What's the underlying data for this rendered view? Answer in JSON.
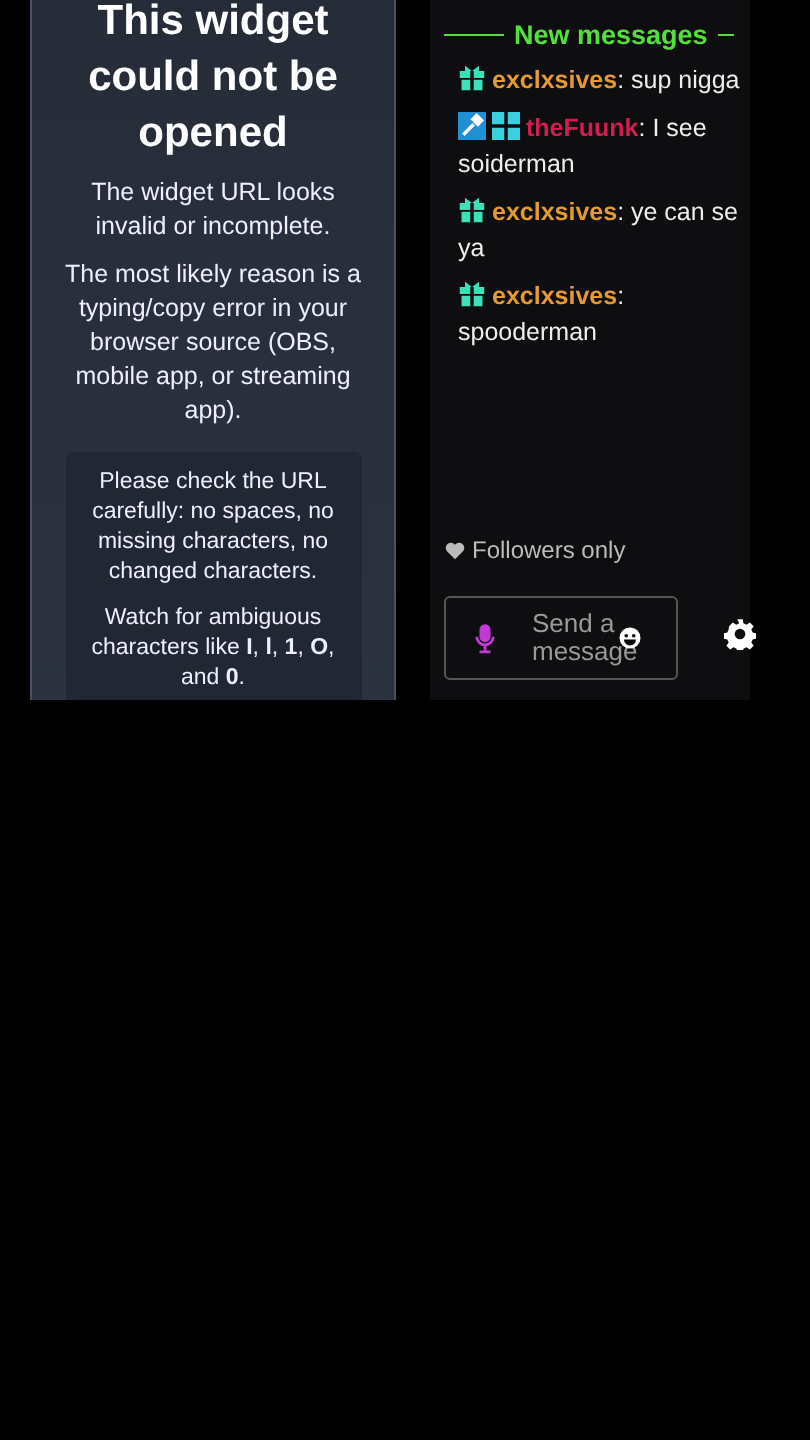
{
  "error_card": {
    "title": "This widget could not be opened",
    "paragraphs": [
      "The widget URL looks invalid or incomplete.",
      "The most likely reason is a typing/copy error in your browser source (OBS, mobile app, or streaming app)."
    ],
    "tip_box": [
      "Please check the URL carefully: no spaces, no missing characters, no changed characters.",
      "Watch for ambiguous characters like **I**, **l**, **1**, **O**, and **0**."
    ]
  },
  "chat": {
    "divider": "New messages",
    "messages": [
      {
        "badges": [
          {
            "kind": "gift"
          }
        ],
        "user": "exclxsives",
        "color": "#e39a35",
        "text": ": sup nigga"
      },
      {
        "badges": [
          {
            "kind": "hammer"
          },
          {
            "kind": "grid"
          }
        ],
        "user": "theFuunk",
        "color": "#d11d50",
        "text": ": I see soiderman"
      },
      {
        "badges": [
          {
            "kind": "gift"
          }
        ],
        "user": "exclxsives",
        "color": "#e39a35",
        "text": ": ye can se ya"
      },
      {
        "badges": [
          {
            "kind": "gift"
          }
        ],
        "user": "exclxsives",
        "color": "#e39a35",
        "text": ": spooderman"
      }
    ],
    "mode": "Followers only",
    "input": {
      "placeholder": "Send a message"
    }
  }
}
